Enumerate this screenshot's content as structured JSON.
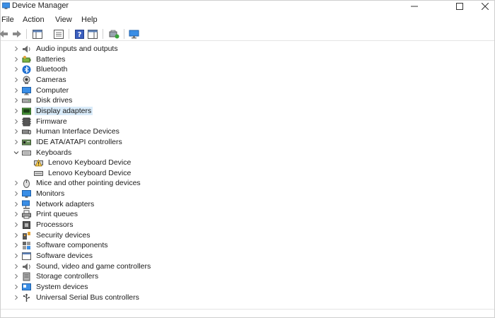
{
  "window": {
    "title": "Device Manager"
  },
  "menu": [
    "File",
    "Action",
    "View",
    "Help"
  ],
  "toolbar": [
    "back-arrow-icon",
    "forward-arrow-icon",
    "properties-pane-icon",
    "details-icon",
    "help-icon",
    "console-tree-icon",
    "update-driver-icon",
    "scan-hardware-icon"
  ],
  "tree": [
    {
      "label": "Audio inputs and outputs",
      "icon": "speaker-icon",
      "expanded": false
    },
    {
      "label": "Batteries",
      "icon": "battery-icon",
      "expanded": false
    },
    {
      "label": "Bluetooth",
      "icon": "bluetooth-icon",
      "expanded": false
    },
    {
      "label": "Cameras",
      "icon": "camera-icon",
      "expanded": false
    },
    {
      "label": "Computer",
      "icon": "computer-icon",
      "expanded": false
    },
    {
      "label": "Disk drives",
      "icon": "disk-drive-icon",
      "expanded": false
    },
    {
      "label": "Display adapters",
      "icon": "display-adapter-icon",
      "expanded": false,
      "selected": true
    },
    {
      "label": "Firmware",
      "icon": "firmware-icon",
      "expanded": false
    },
    {
      "label": "Human Interface Devices",
      "icon": "hid-icon",
      "expanded": false
    },
    {
      "label": "IDE ATA/ATAPI controllers",
      "icon": "ide-controller-icon",
      "expanded": false
    },
    {
      "label": "Keyboards",
      "icon": "keyboard-icon",
      "expanded": true
    },
    {
      "label": "Lenovo Keyboard Device",
      "icon": "keyboard-warning-icon",
      "child": true
    },
    {
      "label": "Lenovo Keyboard Device",
      "icon": "keyboard-icon",
      "child": true
    },
    {
      "label": "Mice and other pointing devices",
      "icon": "mouse-icon",
      "expanded": false
    },
    {
      "label": "Monitors",
      "icon": "monitor-icon",
      "expanded": false
    },
    {
      "label": "Network adapters",
      "icon": "network-adapter-icon",
      "expanded": false
    },
    {
      "label": "Print queues",
      "icon": "printer-icon",
      "expanded": false
    },
    {
      "label": "Processors",
      "icon": "processor-icon",
      "expanded": false
    },
    {
      "label": "Security devices",
      "icon": "security-device-icon",
      "expanded": false
    },
    {
      "label": "Software components",
      "icon": "software-component-icon",
      "expanded": false
    },
    {
      "label": "Software devices",
      "icon": "software-device-icon",
      "expanded": false
    },
    {
      "label": "Sound, video and game controllers",
      "icon": "sound-controller-icon",
      "expanded": false
    },
    {
      "label": "Storage controllers",
      "icon": "storage-controller-icon",
      "expanded": false
    },
    {
      "label": "System devices",
      "icon": "system-device-icon",
      "expanded": false
    },
    {
      "label": "Universal Serial Bus controllers",
      "icon": "usb-icon",
      "expanded": false
    }
  ],
  "colors": {
    "selection": "#d9ebf9",
    "accent": "#1f6fd1"
  }
}
